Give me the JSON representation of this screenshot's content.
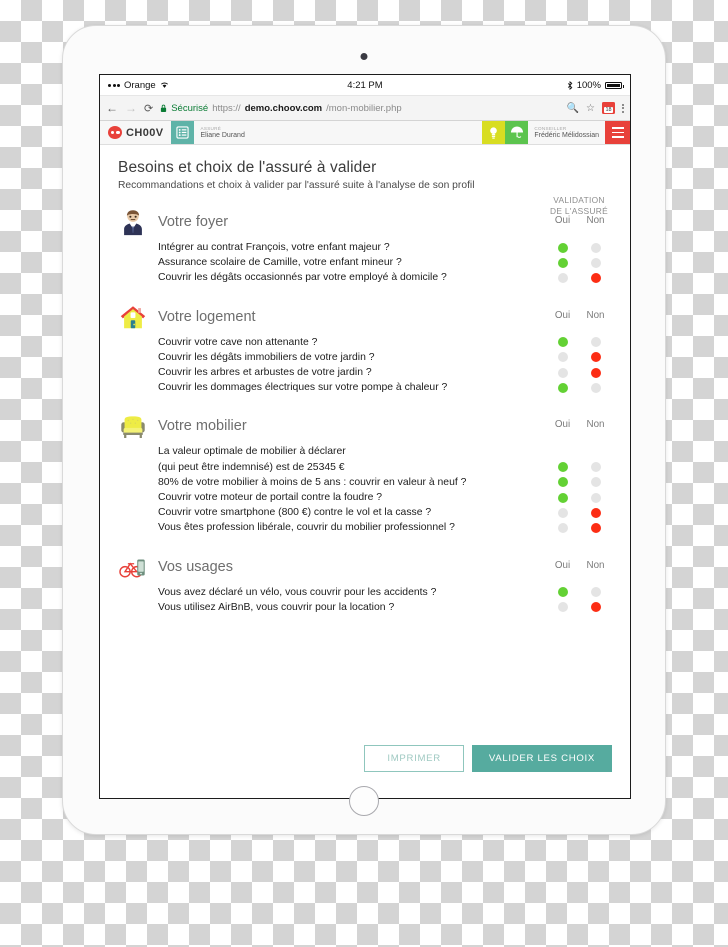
{
  "status_bar": {
    "carrier": "Orange",
    "wifi_icon": "wifi-icon",
    "time": "4:21 PM",
    "bluetooth_icon": "bluetooth-icon",
    "battery_percent": "100%"
  },
  "browser": {
    "back_icon": "back-arrow-icon",
    "forward_icon": "forward-arrow-icon",
    "reload_icon": "reload-icon",
    "lock_icon": "lock-icon",
    "secure_label": "Sécurisé",
    "url_scheme": "https://",
    "url_host": "demo.choov.com",
    "url_path": "/mon-mobilier.php",
    "search_icon": "search-icon",
    "bookmark_icon": "star-icon",
    "extension_badge": "18",
    "menu_icon": "kebab-menu-icon"
  },
  "app_header": {
    "brand": "CH00V",
    "list_icon": "list-icon",
    "insured_role": "ASSURÉ",
    "insured_name": "Eliane Durand",
    "lightbulb_icon": "lightbulb-icon",
    "umbrella_icon": "umbrella-icon",
    "advisor_role": "CONSEILLER",
    "advisor_name": "Frédéric Mélidossian",
    "burger_icon": "hamburger-menu-icon"
  },
  "page": {
    "title": "Besoins et choix de l'assuré à valider",
    "subtitle": "Recommandations et choix à valider par l'assuré suite à l'analyse de son profil",
    "validation_header_line1": "VALIDATION",
    "validation_header_line2": "DE L'ASSURÉ",
    "col_yes": "Oui",
    "col_no": "Non"
  },
  "sections": [
    {
      "id": "votre-foyer",
      "title": "Votre foyer",
      "icon": "person-avatar-icon",
      "questions": [
        {
          "text": "Intégrer au contrat François, votre enfant majeur ?",
          "answer": "oui"
        },
        {
          "text": "Assurance scolaire de Camille, votre enfant mineur ?",
          "answer": "oui"
        },
        {
          "text": "Couvrir les dégâts occasionnés par votre employé à domicile ?",
          "answer": "non"
        }
      ]
    },
    {
      "id": "votre-logement",
      "title": "Votre logement",
      "icon": "house-icon",
      "questions": [
        {
          "text": "Couvrir votre cave non attenante ?",
          "answer": "oui"
        },
        {
          "text": "Couvrir les dégâts immobiliers de votre jardin ?",
          "answer": "non"
        },
        {
          "text": "Couvrir les arbres et arbustes de votre jardin ?",
          "answer": "non"
        },
        {
          "text": "Couvrir les dommages électriques sur votre pompe à chaleur ?",
          "answer": "oui"
        }
      ]
    },
    {
      "id": "votre-mobilier",
      "title": "Votre mobilier",
      "icon": "armchair-icon",
      "questions": [
        {
          "text": "La valeur optimale de mobilier à déclarer",
          "answer": "none"
        },
        {
          "text": "(qui peut être indemnisé) est de 25345 €",
          "answer": "oui"
        },
        {
          "text": "80% de votre mobilier à moins de 5 ans : couvrir en valeur à neuf ?",
          "answer": "oui"
        },
        {
          "text": "Couvrir votre moteur de portail contre la foudre ?",
          "answer": "oui"
        },
        {
          "text": "Couvrir votre smartphone (800 €) contre le vol et la casse ?",
          "answer": "non"
        },
        {
          "text": "Vous êtes profession libérale, couvrir du mobilier professionnel ?",
          "answer": "non"
        }
      ]
    },
    {
      "id": "vos-usages",
      "title": "Vos usages",
      "icon": "bicycle-icon",
      "questions": [
        {
          "text": "Vous avez déclaré un vélo, vous couvrir pour les accidents ?",
          "answer": "oui"
        },
        {
          "text": "Vous utilisez AirBnB, vous couvrir pour la location ?",
          "answer": "non"
        }
      ]
    }
  ],
  "footer": {
    "print_label": "IMPRIMER",
    "validate_label": "VALIDER LES CHOIX"
  },
  "colors": {
    "brand_red": "#e8413a",
    "teal": "#56ab9f",
    "yes_green": "#63d134",
    "no_red": "#fc2d14",
    "dot_off": "#e4e4e4"
  }
}
